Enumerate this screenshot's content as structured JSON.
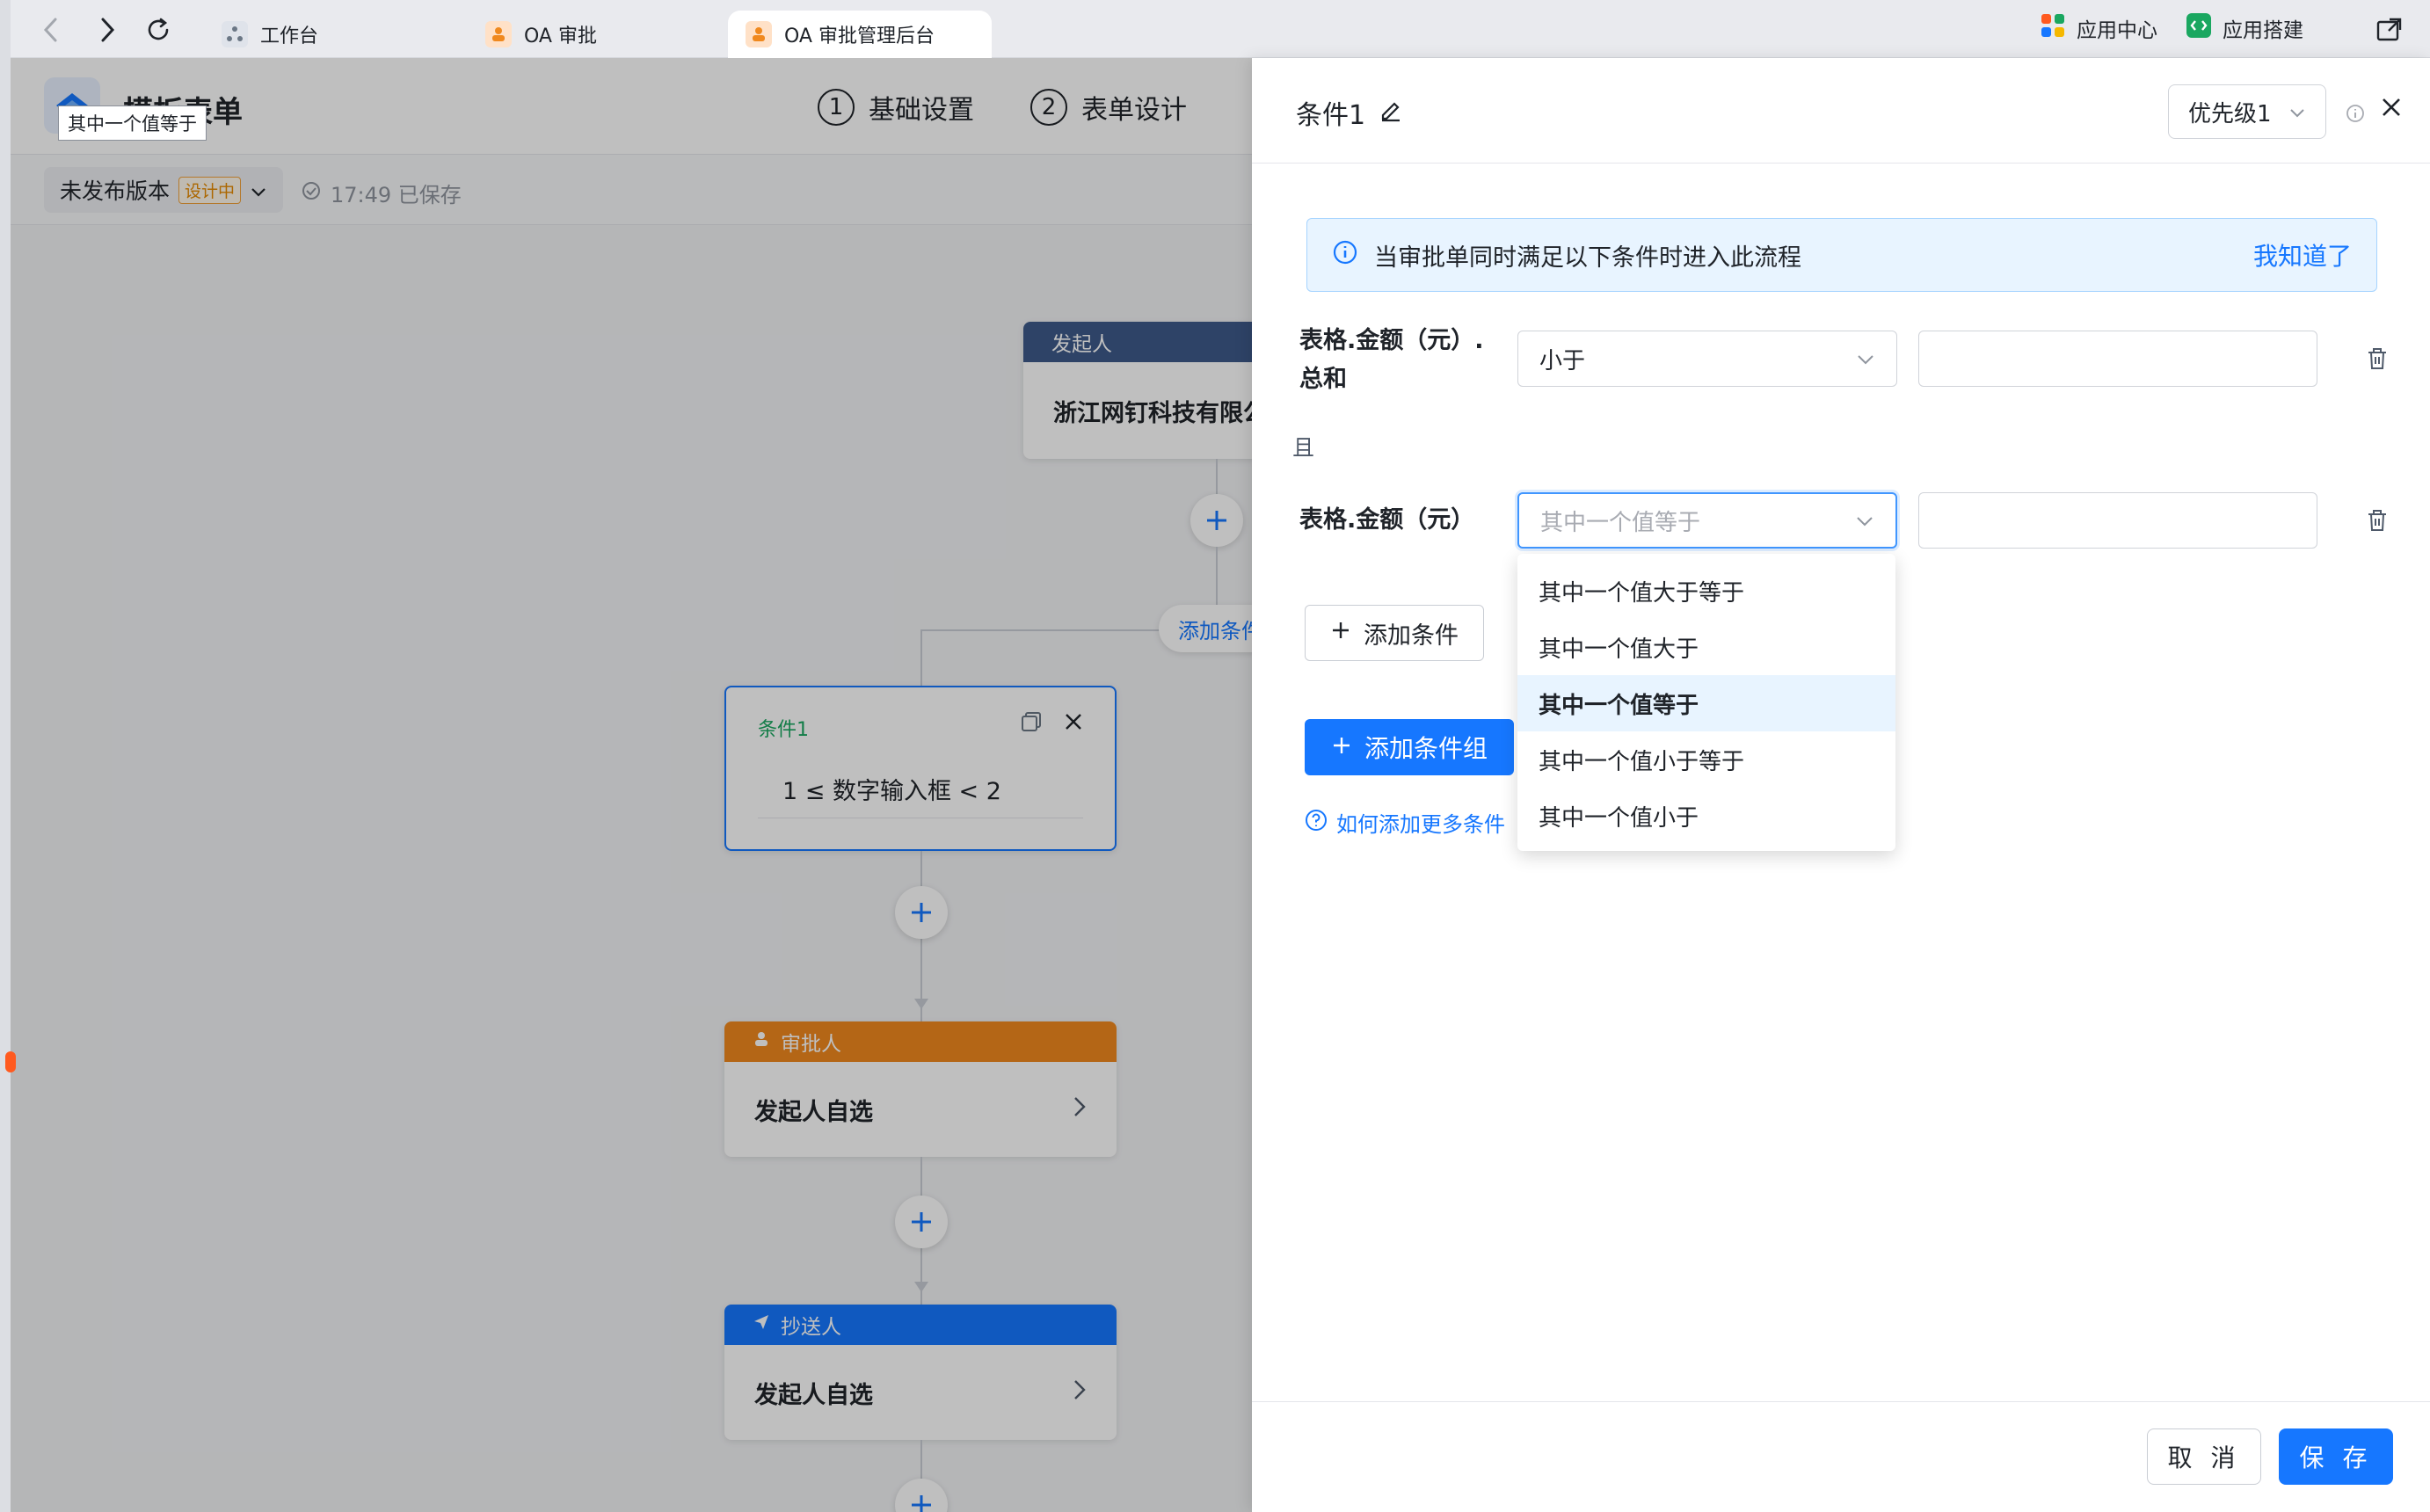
{
  "browser": {
    "tabs": [
      {
        "label": "工作台"
      },
      {
        "label": "OA 审批"
      },
      {
        "label": "OA 审批管理后台"
      }
    ],
    "app_center": "应用中心",
    "app_builder": "应用搭建"
  },
  "header": {
    "title": "模板表单",
    "tooltip": "其中一个值等于",
    "steps": [
      {
        "num": "1",
        "label": "基础设置"
      },
      {
        "num": "2",
        "label": "表单设计"
      }
    ]
  },
  "subbar": {
    "version": "未发布版本",
    "badge": "设计中",
    "saved": "17:49 已保存"
  },
  "flow": {
    "initiator_head": "发起人",
    "initiator_body": "浙江网钉科技有限公",
    "add_branch": "添加条件",
    "condition_title": "条件1",
    "condition_expr": "1 ≤ 数字输入框 < 2",
    "approver_head": "审批人",
    "approver_body": "发起人自选",
    "cc_head": "抄送人",
    "cc_body": "发起人自选"
  },
  "drawer": {
    "title": "条件1",
    "priority": "优先级1",
    "alert_text": "当审批单同时满足以下条件时进入此流程",
    "alert_ack": "我知道了",
    "conditions": [
      {
        "label_line1": "表格.金额（元）.",
        "label_line2": "总和",
        "operator": "小于",
        "value": ""
      },
      {
        "label_line1": "表格.金额（元）",
        "operator_placeholder": "其中一个值等于",
        "value": ""
      }
    ],
    "and_label": "且",
    "add_condition": "添加条件",
    "add_group": "添加条件组",
    "help": "如何添加更多条件",
    "dropdown_options": [
      "其中一个值大于等于",
      "其中一个值大于",
      "其中一个值等于",
      "其中一个值小于等于",
      "其中一个值小于"
    ],
    "dropdown_selected_index": 2,
    "cancel": "取 消",
    "save": "保 存"
  },
  "colors": {
    "primary": "#1677ff",
    "initiator_head": "#3e5a8a",
    "approver_head": "#f0891e",
    "cc_head": "#1677ff",
    "condition_green": "#1aa760"
  }
}
